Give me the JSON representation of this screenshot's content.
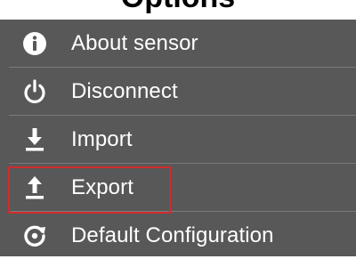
{
  "header": {
    "title_fragment": "Options"
  },
  "menu": {
    "items": [
      {
        "label": "About sensor",
        "icon": "info-icon"
      },
      {
        "label": "Disconnect",
        "icon": "power-icon"
      },
      {
        "label": "Import",
        "icon": "download-icon"
      },
      {
        "label": "Export",
        "icon": "upload-icon"
      },
      {
        "label": "Default Configuration",
        "icon": "reset-icon"
      }
    ],
    "highlighted_item": "Export",
    "colors": {
      "menu_background": "#585858",
      "separator": "#7a7a7a",
      "text": "#ffffff",
      "highlight_border": "#d12b2b"
    }
  }
}
